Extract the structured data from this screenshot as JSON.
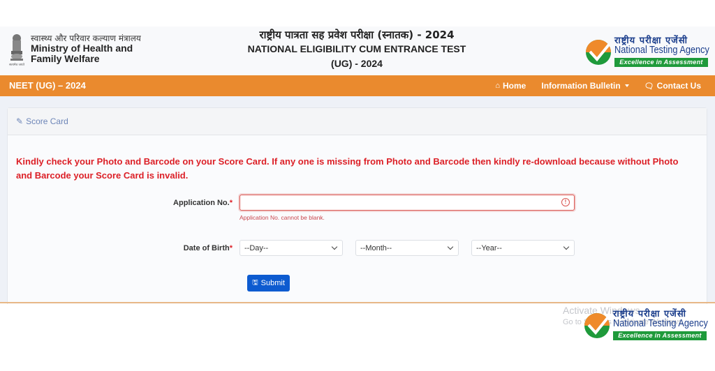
{
  "header": {
    "ministry": {
      "hindi": "स्वास्थ्य और परिवार कल्याण मंत्रालय",
      "english_line1": "Ministry of Health and",
      "english_line2": "Family Welfare",
      "emblem_caption": "सत्यमेव जयते",
      "icon": "national-emblem-icon"
    },
    "title": {
      "hindi": "राष्ट्रीय पात्रता सह प्रवेश परीक्षा (स्नातक) - 2024",
      "english_line1": "NATIONAL ELIGIBILITY CUM ENTRANCE TEST",
      "english_line2": "(UG) - 2024"
    },
    "nta": {
      "hindi": "राष्ट्रीय परीक्षा एजेंसी",
      "english": "National Testing Agency",
      "tagline": "Excellence in Assessment",
      "icon": "nta-logo-icon"
    }
  },
  "navbar": {
    "brand": "NEET (UG) – 2024",
    "color": "#ea8a2e",
    "items": [
      {
        "label": "Home",
        "icon": "home-icon"
      },
      {
        "label": "Information Bulletin",
        "icon": "caret-down-icon",
        "dropdown": true
      },
      {
        "label": "Contact Us",
        "icon": "chat-icon"
      }
    ]
  },
  "card": {
    "title": "Score Card",
    "title_icon": "edit-icon",
    "notice": "Kindly check your Photo and Barcode on your Score Card. If any one is missing from Photo and Barcode then kindly re-download because without Photo and Barcode your Score Card is invalid.",
    "form": {
      "application_label": "Application No.",
      "application_value": "",
      "application_error": "Application No. cannot be blank.",
      "required_mark": "*",
      "dob_label": "Date of Birth",
      "day_selected": "--Day--",
      "month_selected": "--Month--",
      "year_selected": "--Year--",
      "submit_label": "Submit",
      "submit_icon": "save-icon"
    }
  },
  "overlay": {
    "watermark_line1": "Activate Windows",
    "watermark_line2": "Go to Settings to activate Windows."
  },
  "colors": {
    "accent_orange": "#ea8a2e",
    "error_red": "#dc1f26",
    "submit_blue": "#0d5bd0",
    "nta_green": "#1f9a3b",
    "nta_blue": "#1b3e8c"
  }
}
